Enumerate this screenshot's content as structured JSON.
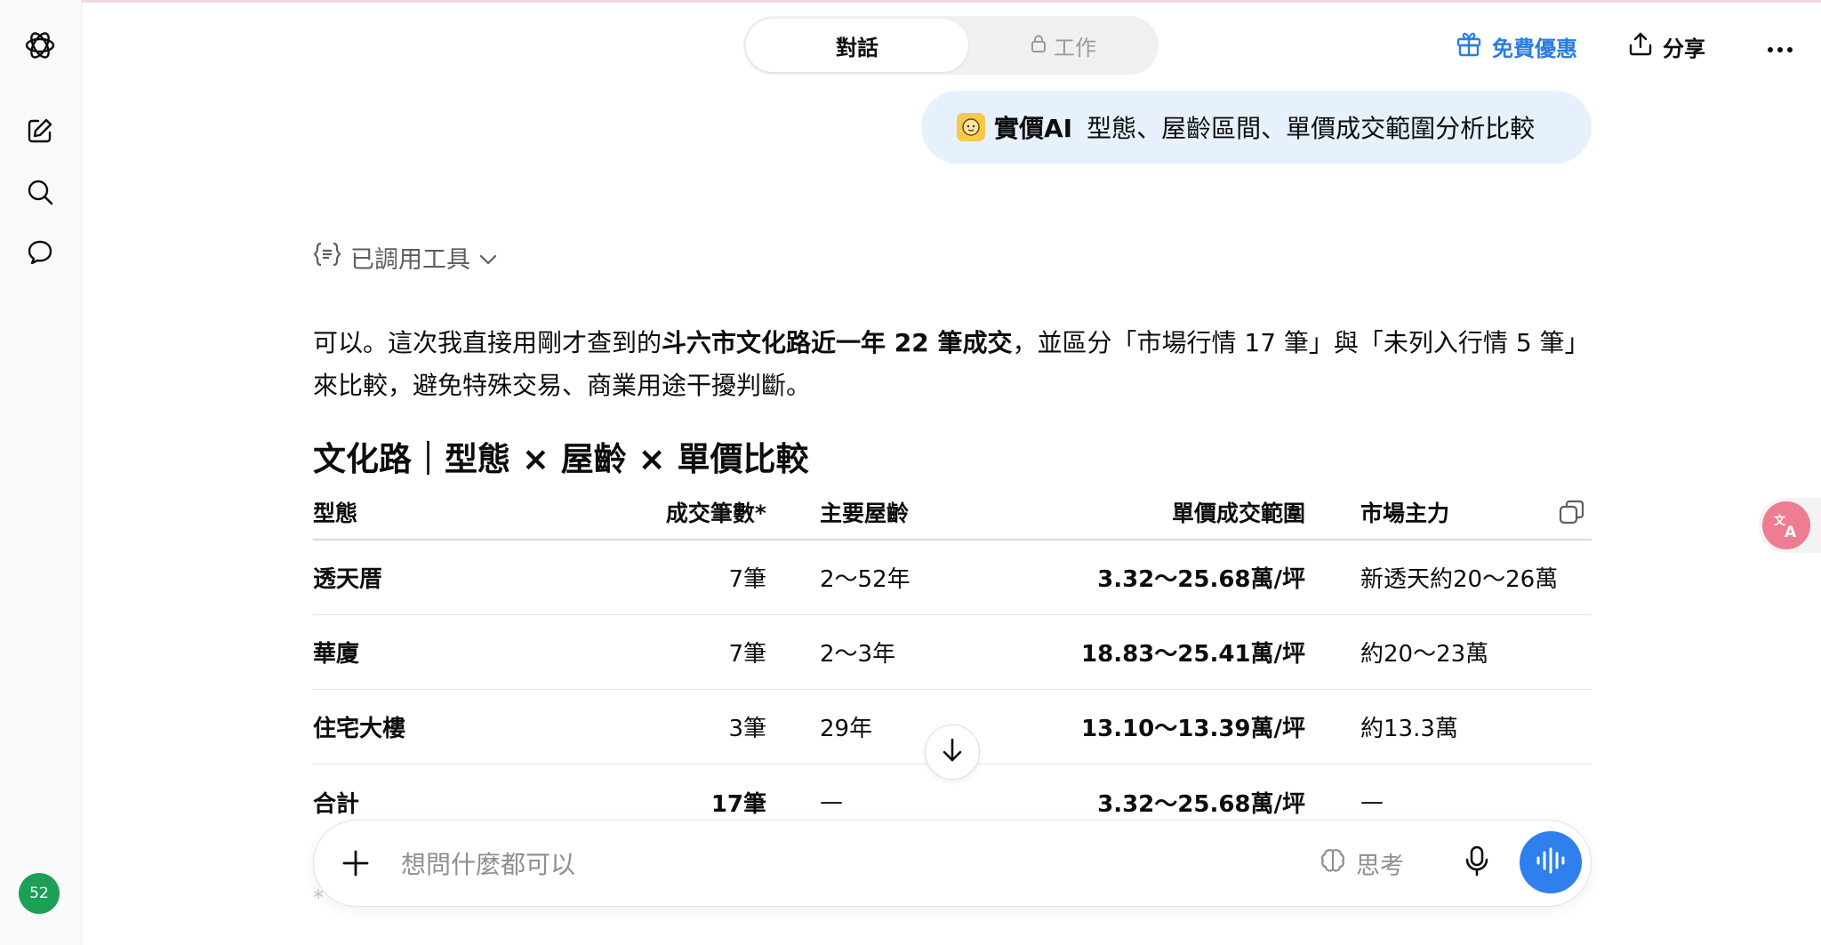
{
  "header": {
    "tabs": [
      {
        "label": "對話",
        "active": true
      },
      {
        "label": "工作",
        "active": false,
        "icon": "lock-icon"
      }
    ],
    "offer_label": "免費優惠",
    "share_label": "分享",
    "accent_color": "#2b7de0"
  },
  "sidebar": {
    "items": [
      {
        "name": "openai-logo-icon"
      },
      {
        "name": "new-chat-icon"
      },
      {
        "name": "search-icon"
      },
      {
        "name": "chats-icon"
      }
    ],
    "avatar_badge": "52"
  },
  "user_message": {
    "gpt_name": "實價AI",
    "text": "型態、屋齡區間、單價成交範圍分析比較"
  },
  "tools": {
    "label": "已調用工具"
  },
  "answer": {
    "p1": "可以。這次我直接用剛才查到的",
    "p1_bold": "斗六市文化路近一年 22 筆成交",
    "p1_rest": "，並區分「市場行情 17 筆」與「未列入行情 5 筆」來比較，避免特殊交易、商業用途干擾判斷。",
    "heading": "文化路｜型態 × 屋齡 × 單價比較"
  },
  "table": {
    "headers": [
      "型態",
      "成交筆數*",
      "主要屋齡",
      "單價成交範圍",
      "市場主力"
    ],
    "rows": [
      [
        "透天厝",
        "7筆",
        "2～52年",
        "3.32～25.68萬/坪",
        "新透天約20～26萬"
      ],
      [
        "華廈",
        "7筆",
        "2～3年",
        "18.83～25.41萬/坪",
        "約20～23萬"
      ],
      [
        "住宅大樓",
        "3筆",
        "29年",
        "13.10～13.39萬/坪",
        "約13.3萬"
      ],
      [
        "合計",
        "17筆",
        "—",
        "3.32～25.68萬/坪",
        "—"
      ]
    ]
  },
  "composer": {
    "placeholder": "想問什麼都可以",
    "think_label": "思考"
  },
  "footnote": "*"
}
